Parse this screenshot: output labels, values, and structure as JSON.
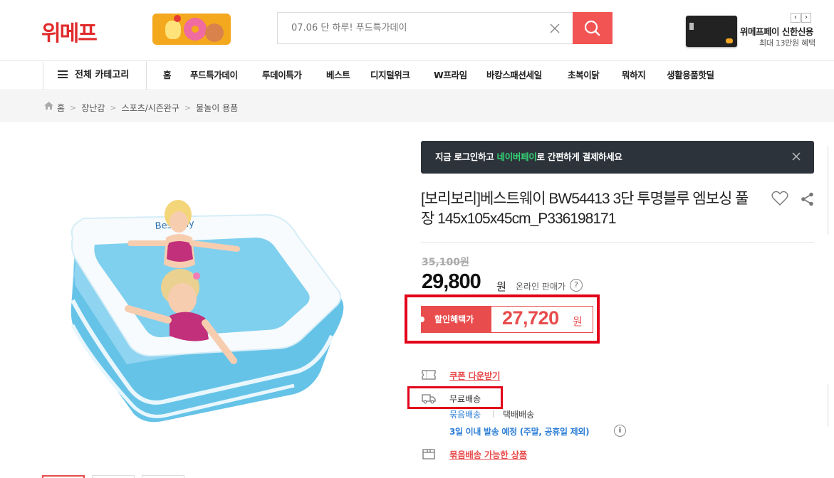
{
  "header": {
    "logo": "위메프",
    "search_placeholder": "07.06 단 하루! 푸드특가데이",
    "ad": {
      "title": "위메프페이 신한신용",
      "subtitle": "최대 13만원 혜택",
      "prev": "‹",
      "next": "›"
    }
  },
  "nav": {
    "all_categories": "전체 카테고리",
    "items": [
      "홈",
      "푸드특가데이",
      "투데이특가",
      "베스트",
      "디지털위크",
      "W프라임",
      "바캉스패션세일",
      "초복이닭",
      "뭐하지",
      "생활용품핫딜"
    ]
  },
  "breadcrumb": [
    "홈",
    "장난감",
    "스포츠/시즌완구",
    "물놀이 용품"
  ],
  "banner": {
    "prefix": "지금 로그인하고 ",
    "highlight": "네이버페이",
    "suffix": "로 간편하게 결제하세요"
  },
  "product": {
    "title": "[보리보리]베스트웨이 BW54413 3단 투명블루 엠보싱 풀장 145x105x45cm_P336198171",
    "original_price": "35,100원",
    "price": "29,800",
    "price_unit": "원",
    "online_price_label": "온라인 판매가",
    "discount_label": "할인혜택가",
    "discount_price": "27,720",
    "discount_unit": "원"
  },
  "shipping": {
    "coupon_link": "쿠폰 다운받기",
    "free_shipping": "무료배송",
    "bundle": "묶음배송",
    "parcel": "택배배송",
    "schedule": "3일 이내 발송 예정 (주말, 공휴일 제외)",
    "bundle_link": "묶음배송 가능한 상품"
  },
  "icons": [
    "search-icon",
    "close-icon",
    "home-icon",
    "heart-icon",
    "share-icon",
    "question-icon",
    "coupon-icon",
    "truck-icon",
    "info-icon",
    "box-icon",
    "hamburger-icon"
  ],
  "colors": {
    "brand_red": "#e12b2b",
    "accent_red": "#e84c4c",
    "search_button": "#f25353",
    "banner_bg": "#2d333a",
    "naverpay_green": "#34d377",
    "link_blue": "#2f7fd6",
    "annotation_red": "#e2001a"
  }
}
